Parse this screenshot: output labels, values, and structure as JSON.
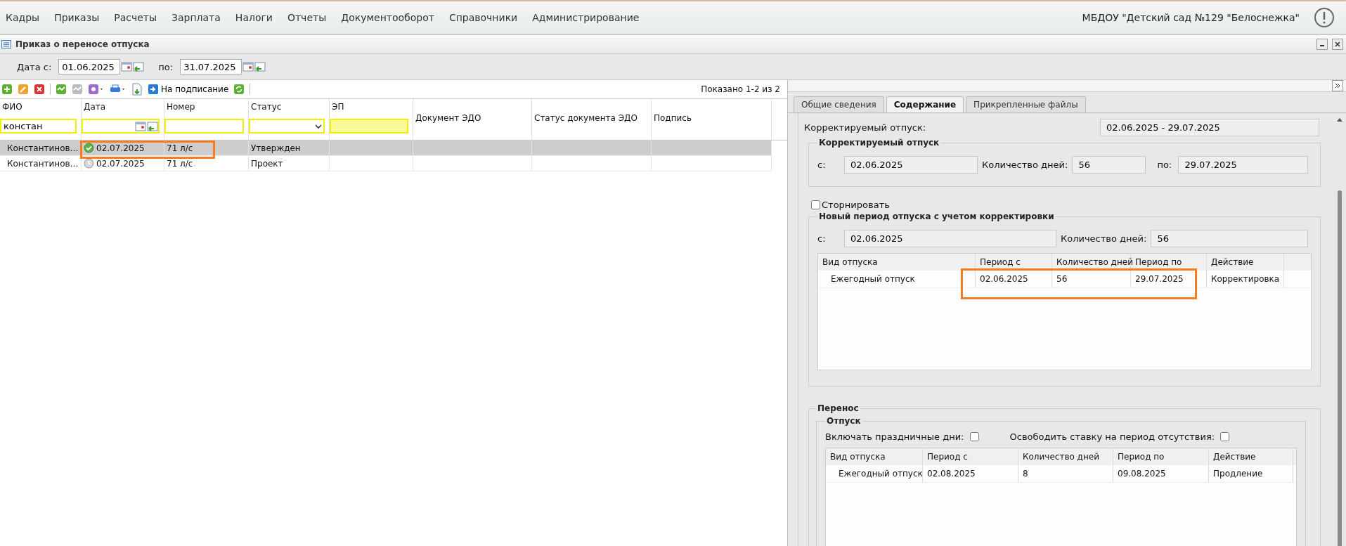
{
  "menu": [
    {
      "label": "Кадры"
    },
    {
      "label": "Приказы"
    },
    {
      "label": "Расчеты"
    },
    {
      "label": "Зарплата"
    },
    {
      "label": "Налоги"
    },
    {
      "label": "Отчеты"
    },
    {
      "label": "Документооборот"
    },
    {
      "label": "Справочники"
    },
    {
      "label": "Администрирование"
    }
  ],
  "organization": "МБДОУ \"Детский сад №129 \"Белоснежка\"",
  "window": {
    "title": "Приказ о переносе отпуска"
  },
  "date_filter": {
    "from_label": "Дата с:",
    "from_value": "01.06.2025",
    "to_label": "по:",
    "to_value": "31.07.2025"
  },
  "toolbar": {
    "sign_button": "На подписание",
    "count": "Показано 1-2 из 2"
  },
  "table": {
    "columns": [
      {
        "label": "ФИО",
        "kind": "text",
        "filter_value": "констан"
      },
      {
        "label": "Дата",
        "kind": "date"
      },
      {
        "label": "Номер",
        "kind": "text"
      },
      {
        "label": "Статус",
        "kind": "select"
      },
      {
        "label": "ЭП",
        "kind": "flag"
      },
      {
        "label": "Документ ЭДО",
        "kind": "plain"
      },
      {
        "label": "Статус документа ЭДО",
        "kind": "plain"
      },
      {
        "label": "Подпись",
        "kind": "plain"
      }
    ],
    "rows": [
      {
        "selected": true,
        "approved": true,
        "cells": [
          "Константинов…",
          "02.07.2025",
          "71 л/с",
          "Утвержден",
          "",
          "",
          "",
          ""
        ]
      },
      {
        "selected": false,
        "approved": false,
        "cells": [
          "Константинов…",
          "02.07.2025",
          "71 л/с",
          "Проект",
          "",
          "",
          "",
          ""
        ]
      }
    ]
  },
  "right_panel": {
    "tabs": [
      {
        "label": "Общие сведения",
        "selected": false
      },
      {
        "label": "Содержание",
        "selected": true
      },
      {
        "label": "Прикрепленные файлы",
        "selected": false
      }
    ],
    "corrected_label": "Корректируемый отпуск:",
    "corrected_value": "02.06.2025 - 29.07.2025",
    "corrected_group": {
      "title": "Корректируемый отпуск",
      "from_label": "с:",
      "from_value": "02.06.2025",
      "days_label": "Количество дней:",
      "days_value": "56",
      "to_label": "по:",
      "to_value": "29.07.2025"
    },
    "storno": {
      "label": "Сторнировать",
      "checked": false
    },
    "new_period": {
      "title": "Новый период отпуска с учетом корректировки",
      "from_label": "с:",
      "from_value": "02.06.2025",
      "days_label": "Количество дней:",
      "days_value": "56",
      "grid": {
        "columns": [
          "Вид отпуска",
          "Период с",
          "Количество дней",
          "Период по",
          "Действие"
        ],
        "rows": [
          [
            "Ежегодный отпуск",
            "02.06.2025",
            "56",
            "29.07.2025",
            "Корректировка"
          ]
        ]
      }
    },
    "transfer": {
      "title": "Перенос",
      "group_title": "Отпуск",
      "holidays": {
        "label": "Включать праздничные дни:",
        "checked": false
      },
      "free_rate": {
        "label": "Освободить ставку на период отсутствия:",
        "checked": false
      },
      "grid": {
        "columns": [
          "Вид отпуска",
          "Период с",
          "Количество дней",
          "Период по",
          "Действие"
        ],
        "rows": [
          [
            "Ежегодный отпуск",
            "02.08.2025",
            "8",
            "09.08.2025",
            "Продление"
          ]
        ]
      }
    }
  }
}
